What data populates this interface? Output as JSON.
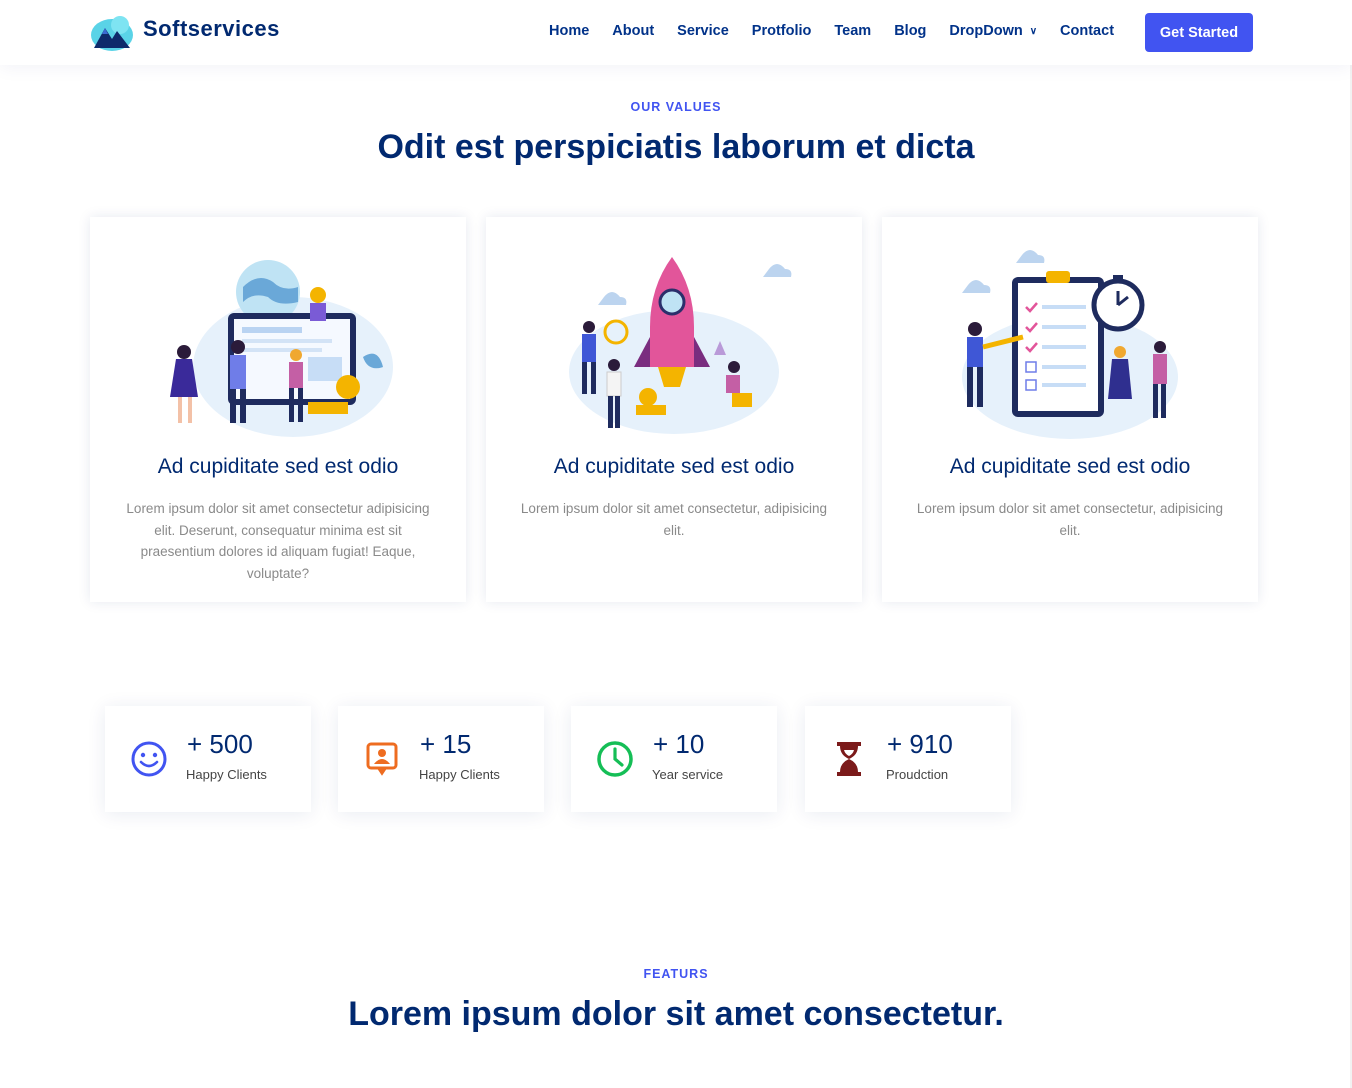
{
  "brand": {
    "name": "Softservices"
  },
  "nav": {
    "items": [
      "Home",
      "About",
      "Service",
      "Protfolio",
      "Team",
      "Blog",
      "DropDown",
      "Contact"
    ],
    "cta": "Get Started"
  },
  "values": {
    "kicker": "OUR VALUES",
    "title": "Odit est perspiciatis laborum et dicta",
    "cards": [
      {
        "title": "Ad cupiditate sed est odio",
        "text": "Lorem ipsum dolor sit amet consectetur adipisicing elit. Deserunt, consequatur minima est sit praesentium dolores id aliquam fugiat! Eaque, voluptate?",
        "illustration": "team-globe-dashboard-illustration"
      },
      {
        "title": "Ad cupiditate sed est odio",
        "text": "Lorem ipsum dolor sit amet consectetur, adipisicing elit.",
        "illustration": "rocket-launch-illustration"
      },
      {
        "title": "Ad cupiditate sed est odio",
        "text": "Lorem ipsum dolor sit amet consectetur, adipisicing elit.",
        "illustration": "checklist-clock-illustration"
      }
    ]
  },
  "counters": [
    {
      "value": "+ 500",
      "label": "Happy Clients",
      "icon": "smiley-icon",
      "color": "#4154f1"
    },
    {
      "value": "+ 15",
      "label": "Happy Clients",
      "icon": "person-badge-icon",
      "color": "#ee6c20"
    },
    {
      "value": "+ 10",
      "label": "Year service",
      "icon": "clock-icon",
      "color": "#15be56"
    },
    {
      "value": "+ 910",
      "label": "Proudction",
      "icon": "hourglass-icon",
      "color": "#7b1a1a"
    }
  ],
  "features": {
    "kicker": "FEATURS",
    "title": "Lorem ipsum dolor sit amet consectetur."
  },
  "colors": {
    "primary": "#4154f1",
    "heading": "#012970",
    "text_muted": "#8a8a8a"
  }
}
